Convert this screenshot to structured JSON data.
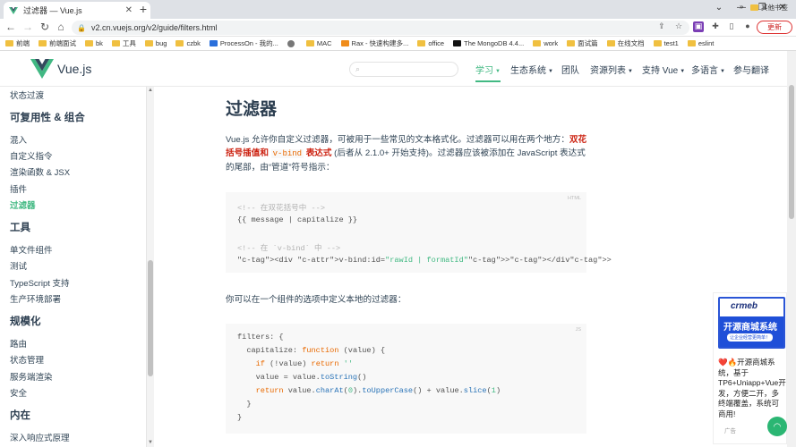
{
  "browser": {
    "tab_title": "过滤器 — Vue.js",
    "url": "v2.cn.vuejs.org/v2/guide/filters.html",
    "update_label": "更新",
    "bookmarks": [
      {
        "label": "前端",
        "color": "#f0c040"
      },
      {
        "label": "前端面试",
        "color": "#f0c040"
      },
      {
        "label": "bk",
        "color": "#f0c040"
      },
      {
        "label": "工具",
        "color": "#f0c040"
      },
      {
        "label": "bug",
        "color": "#f0c040"
      },
      {
        "label": "czbk",
        "color": "#f0c040"
      },
      {
        "label": "ProcessOn - 我的...",
        "color": "#2a6fdb"
      },
      {
        "label": "",
        "color": "#777"
      },
      {
        "label": "MAC",
        "color": "#f0c040"
      },
      {
        "label": "Rax - 快速构建多...",
        "color": "#f08c1a"
      },
      {
        "label": "office",
        "color": "#f0c040"
      },
      {
        "label": "The MongoDB 4.4...",
        "color": "#111"
      },
      {
        "label": "work",
        "color": "#f0c040"
      },
      {
        "label": "面试篇",
        "color": "#f0c040"
      },
      {
        "label": "在线文档",
        "color": "#f0c040"
      },
      {
        "label": "test1",
        "color": "#f0c040"
      },
      {
        "label": "eslint",
        "color": "#f0c040"
      }
    ],
    "more_label": "»",
    "other_bookmarks": "其他书签"
  },
  "header": {
    "brand": "Vue.js",
    "nav": [
      {
        "label": "学习",
        "dropdown": true,
        "active": true
      },
      {
        "label": "生态系统",
        "dropdown": true
      },
      {
        "label": "团队",
        "dropdown": false
      },
      {
        "label": "资源列表",
        "dropdown": true
      },
      {
        "label": "支持 Vue",
        "dropdown": true
      },
      {
        "label": "多语言",
        "dropdown": true
      },
      {
        "label": "参与翻译",
        "dropdown": false
      }
    ]
  },
  "sidebar": {
    "items": [
      {
        "label": "状态过渡",
        "type": "item"
      },
      {
        "label": "可复用性 & 组合",
        "type": "head"
      },
      {
        "label": "混入",
        "type": "item"
      },
      {
        "label": "自定义指令",
        "type": "item"
      },
      {
        "label": "渲染函数 & JSX",
        "type": "item"
      },
      {
        "label": "插件",
        "type": "item"
      },
      {
        "label": "过滤器",
        "type": "current"
      },
      {
        "label": "工具",
        "type": "head"
      },
      {
        "label": "单文件组件",
        "type": "item"
      },
      {
        "label": "测试",
        "type": "item"
      },
      {
        "label": "TypeScript 支持",
        "type": "item"
      },
      {
        "label": "生产环境部署",
        "type": "item"
      },
      {
        "label": "规模化",
        "type": "head"
      },
      {
        "label": "路由",
        "type": "item"
      },
      {
        "label": "状态管理",
        "type": "item"
      },
      {
        "label": "服务端渲染",
        "type": "item"
      },
      {
        "label": "安全",
        "type": "item"
      },
      {
        "label": "内在",
        "type": "head"
      },
      {
        "label": "深入响应式原理",
        "type": "item"
      }
    ]
  },
  "content": {
    "title": "过滤器",
    "intro_1": "Vue.js 允许你自定义过滤器，可被用于一些常见的文本格式化。过滤器可以用在两个地方：",
    "intro_bold_1": "双花括号插值和",
    "intro_code": "v-bind",
    "intro_bold_2": "表达式",
    "intro_2": "(后者从 2.1.0+ 开始支持)。过滤器应该被添加在 JavaScript 表达式的尾部，由“管道”符号指示：",
    "code1_lang": "HTML",
    "code1": [
      "<!-- 在双花括号中 -->",
      "{{ message | capitalize }}",
      "",
      "<!-- 在 `v-bind` 中 -->",
      "<div v-bind:id=\"rawId | formatId\"></div>"
    ],
    "para2": "你可以在一个组件的选项中定义本地的过滤器：",
    "code2_lang": "JS",
    "code2": [
      "filters: {",
      "  capitalize: function (value) {",
      "    if (!value) return ''",
      "    value = value.toString()",
      "    return value.charAt(0).toUpperCase() + value.slice(1)",
      "  }",
      "}"
    ]
  },
  "ad": {
    "brand": "crmeb",
    "banner_title": "开源商城系统",
    "banner_sub": "让企业经营更简单！",
    "text": "❤️🔥开源商城系统，基于TP6+Uniapp+Vue开发，方便二开，多终端覆盖，系统可商用!",
    "footer": "广告"
  }
}
